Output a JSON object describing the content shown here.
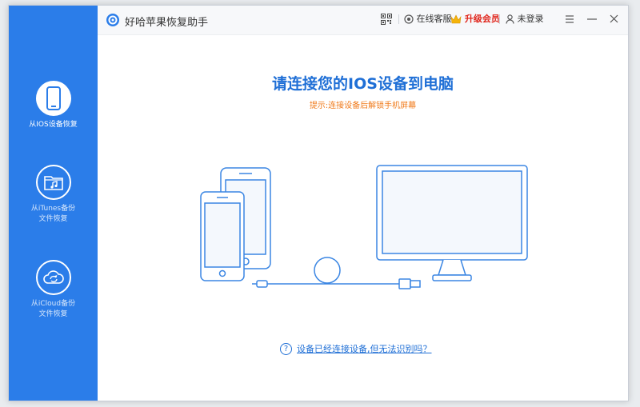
{
  "app": {
    "title": "好哈苹果恢复助手"
  },
  "toolbar": {
    "online_service": "在线客服",
    "upgrade": "升级会员",
    "login": "未登录"
  },
  "sidebar": {
    "items": [
      {
        "label": "从IOS设备恢复",
        "icon": "phone-icon",
        "active": true
      },
      {
        "label_line1": "从iTunes备份",
        "label_line2": "文件恢复",
        "icon": "music-folder-icon",
        "active": false
      },
      {
        "label_line1": "从iCloud备份",
        "label_line2": "文件恢复",
        "icon": "cloud-sync-icon",
        "active": false
      }
    ]
  },
  "main": {
    "title": "请连接您的IOS设备到电脑",
    "hint": "提示:连接设备后解锁手机屏幕",
    "help_link": "设备已经连接设备,但无法识别吗？"
  },
  "colors": {
    "accent": "#2b7de9",
    "title_blue": "#1f6fd6",
    "hint_orange": "#f07a1a",
    "upgrade_red": "#e0251b"
  }
}
